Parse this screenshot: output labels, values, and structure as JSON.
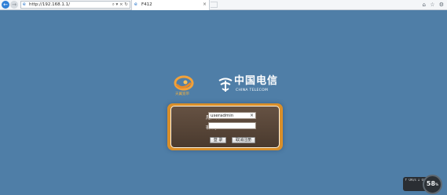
{
  "browser": {
    "back_icon": "back-arrow-icon",
    "forward_icon": "forward-arrow-icon",
    "address_url": "http://192.168.1.1/",
    "address_controls": "⌕ ▾ × ↻",
    "tab_title": "F412",
    "tab_close": "×",
    "toolbar_icons": [
      "home-icon",
      "star-icon",
      "gear-icon"
    ]
  },
  "branding": {
    "left_logo_text": "天翼宽带",
    "right_logo_cn": "中国电信",
    "right_logo_en": "CHINA TELECOM"
  },
  "login": {
    "username_label": "用户名：",
    "password_label": "密  码：",
    "username_value": "useradmin",
    "username_clear": "×",
    "password_value": "",
    "login_button": "登 录",
    "cancel_button": "取消注册"
  },
  "status_widget": {
    "gauge_value": "58",
    "gauge_unit": "%",
    "arrows": "↑ 0K/s  ↓ 0K/s"
  },
  "colors": {
    "page_background": "#4f7ea7",
    "panel_frame": "#d98f2a",
    "panel_body": "#5a483a"
  }
}
